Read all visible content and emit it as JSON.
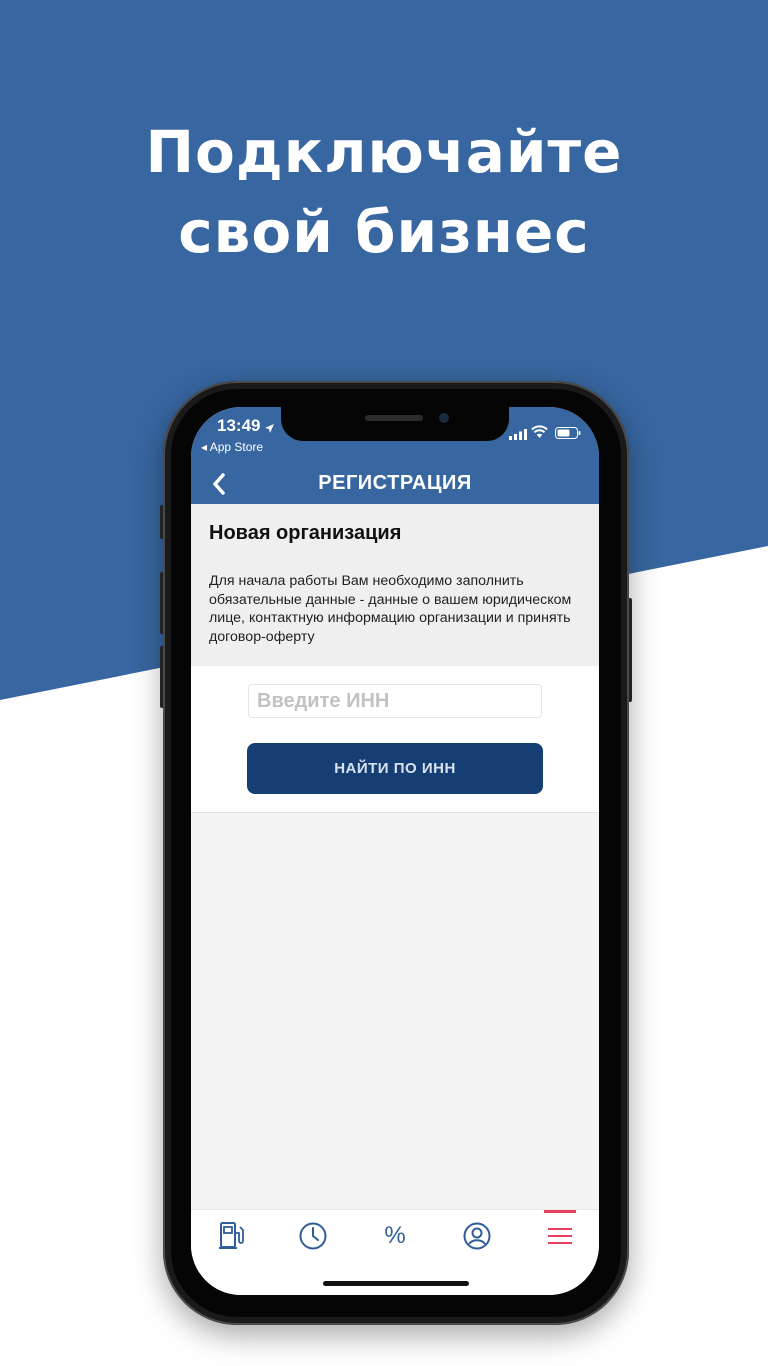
{
  "headline": {
    "line1": "Подключайте",
    "line2": "свой бизнес"
  },
  "statusbar": {
    "time": "13:49",
    "back_app": "◂ App Store",
    "icons": [
      "location-arrow-icon",
      "signal-icon",
      "wifi-icon",
      "battery-icon"
    ]
  },
  "navbar": {
    "title": "РЕГИСТРАЦИЯ",
    "back_icon": "chevron-left-icon"
  },
  "intro": {
    "title": "Новая организация",
    "text": "Для начала работы Вам необходимо заполнить обязательные данные - данные о вашем юридическом лице, контактную информацию организации и принять договор-оферту"
  },
  "form": {
    "inn_value": "",
    "inn_placeholder": "Введите ИНН",
    "find_button": "НАЙТИ ПО ИНН"
  },
  "tabbar": {
    "items": [
      {
        "icon": "fuel-pump-icon"
      },
      {
        "icon": "clock-icon"
      },
      {
        "icon": "percent-icon",
        "glyph": "%"
      },
      {
        "icon": "profile-icon"
      },
      {
        "icon": "menu-icon",
        "active": true
      }
    ]
  },
  "colors": {
    "brand_blue": "#3766a0",
    "button_blue": "#153f74",
    "active_tab": "#e8415f"
  }
}
